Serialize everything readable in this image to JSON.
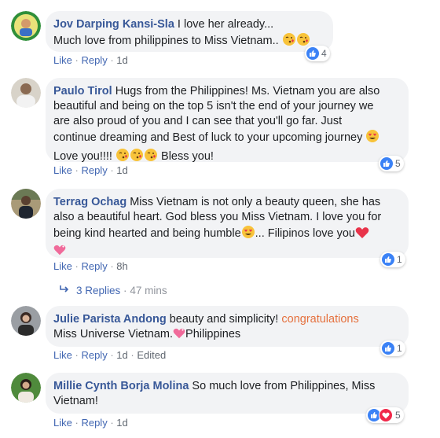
{
  "comments": [
    {
      "author": "Jov Darping Kansi-Sla",
      "text1": " I love her already...",
      "text2": "Much love from philippines to Miss Vietnam..",
      "like": "Like",
      "reply": "Reply",
      "time": "1d",
      "reaction_count": "4"
    },
    {
      "author": "Paulo Tirol",
      "line1": " Hugs from the Philippines! Ms. Vietnam you are also",
      "line2": "beautiful and being on the top 5 isn't the end of your journey we",
      "line3": "are also proud of you and I can see that you'll go far. Just",
      "line4": "continue dreaming and Best of luck to your upcoming journey",
      "line5a": "Love you!!!! ",
      "line5b": " Bless you!",
      "like": "Like",
      "reply": "Reply",
      "time": "1d",
      "reaction_count": "5"
    },
    {
      "author": "Terrag Ochag",
      "line1": " Miss Vietnam is not only a beauty queen, she has",
      "line2": "also a beautiful heart. God bless you Miss Vietnam. I love you for",
      "line3a": "being kind hearted and being humble",
      "line3b": "... Filipinos love you",
      "like": "Like",
      "reply": "Reply",
      "time": "8h",
      "reaction_count": "1",
      "replies_label": "3 Replies",
      "replies_time": "47 mins"
    },
    {
      "author": "Julie Parista Andong",
      "line1a": " beauty and simplicity! ",
      "line1b": "congratulations",
      "line2a": "Miss Universe Vietnam.",
      "line2b": "Philippines",
      "like": "Like",
      "reply": "Reply",
      "time": "1d",
      "edited": "Edited",
      "reaction_count": "1"
    },
    {
      "author": "Millie Cynth Borja Molina",
      "line1": " So much love from Philippines, Miss",
      "line2": "Vietnam!",
      "like": "Like",
      "reply": "Reply",
      "time": "1d",
      "reaction_count": "5"
    }
  ],
  "colors": {
    "author": "#385898",
    "bubble": "#f2f3f5",
    "link": "#4267b2",
    "highlight": "#e5703d",
    "like": "#3b82f6",
    "love": "#f0284a"
  },
  "icons": [
    "kissing-heart-emoji",
    "heart-eyes-emoji",
    "red-heart-emoji",
    "sparkling-heart-emoji",
    "like-icon",
    "love-icon",
    "reply-arrow-icon"
  ]
}
